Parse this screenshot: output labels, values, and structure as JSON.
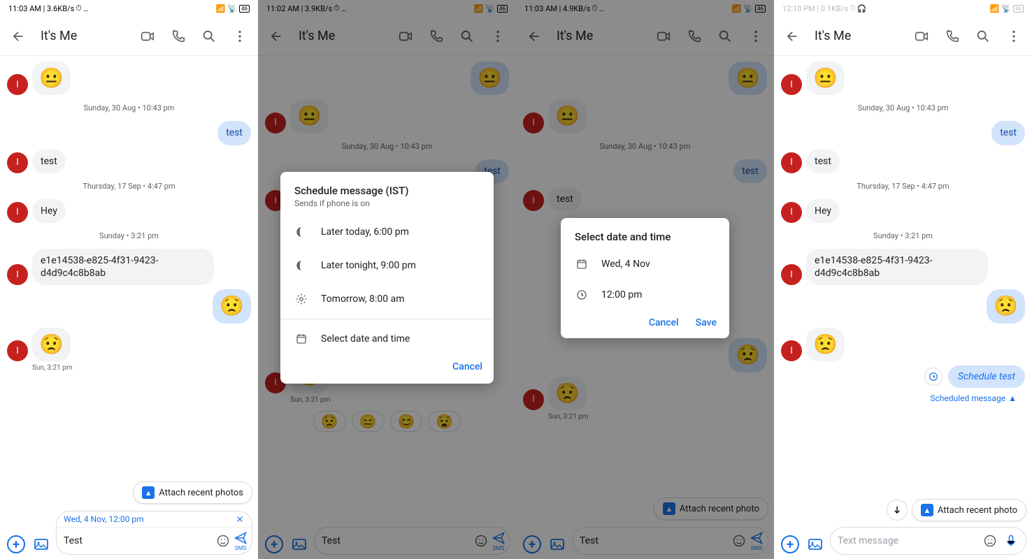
{
  "status": {
    "t1": "11:03 AM | 3.6KB/s",
    "t2": "11:02 AM | 3.9KB/s",
    "t3": "11:03 AM | 4.9KB/s",
    "t4": "12:10 PM | 0.1KB/s",
    "batt": "46"
  },
  "header": {
    "back_icon": "arrow-left",
    "title": "It's Me",
    "icons": [
      "video-icon",
      "call-icon",
      "search-icon",
      "more-icon"
    ]
  },
  "avatar_letter": "I",
  "timestamps": {
    "sun_aug": "Sunday, 30 Aug • 10:43 pm",
    "thu_sep": "Thursday, 17 Sep • 4:47 pm",
    "sun_only": "Sunday • 3:21 pm",
    "sun_short": "Sun, 3:21 pm"
  },
  "messages": {
    "emoji_neutral": "😐",
    "test_out": "test",
    "test_in": "test",
    "hey": "Hey",
    "uuid": "e1e14538-e825-4f31-9423-d4d9c4c8b8ab",
    "emoji_sad_out": "😟",
    "emoji_sad_in": "😟"
  },
  "attach_chip": "Attach recent photos",
  "attach_chip_singular": "Attach recent photo",
  "composer": {
    "scheduled_banner": "Wed, 4 Nov, 12:00 pm",
    "draft": "Test",
    "placeholder": "Text message",
    "sms": "SMS"
  },
  "emoji_suggestions": [
    "😟",
    "😑",
    "😊",
    "😧"
  ],
  "dialog_schedule": {
    "title": "Schedule message (IST)",
    "subtitle": "Sends if phone is on",
    "opts": [
      "Later today, 6:00 pm",
      "Later tonight, 9:00 pm",
      "Tomorrow, 8:00 am",
      "Select date and time"
    ],
    "cancel": "Cancel"
  },
  "dialog_datetime": {
    "title": "Select date and time",
    "date": "Wed, 4 Nov",
    "time": "12:00 pm",
    "cancel": "Cancel",
    "save": "Save"
  },
  "panel4": {
    "schedule_text": "Schedule test",
    "scheduled_label": "Scheduled message"
  }
}
